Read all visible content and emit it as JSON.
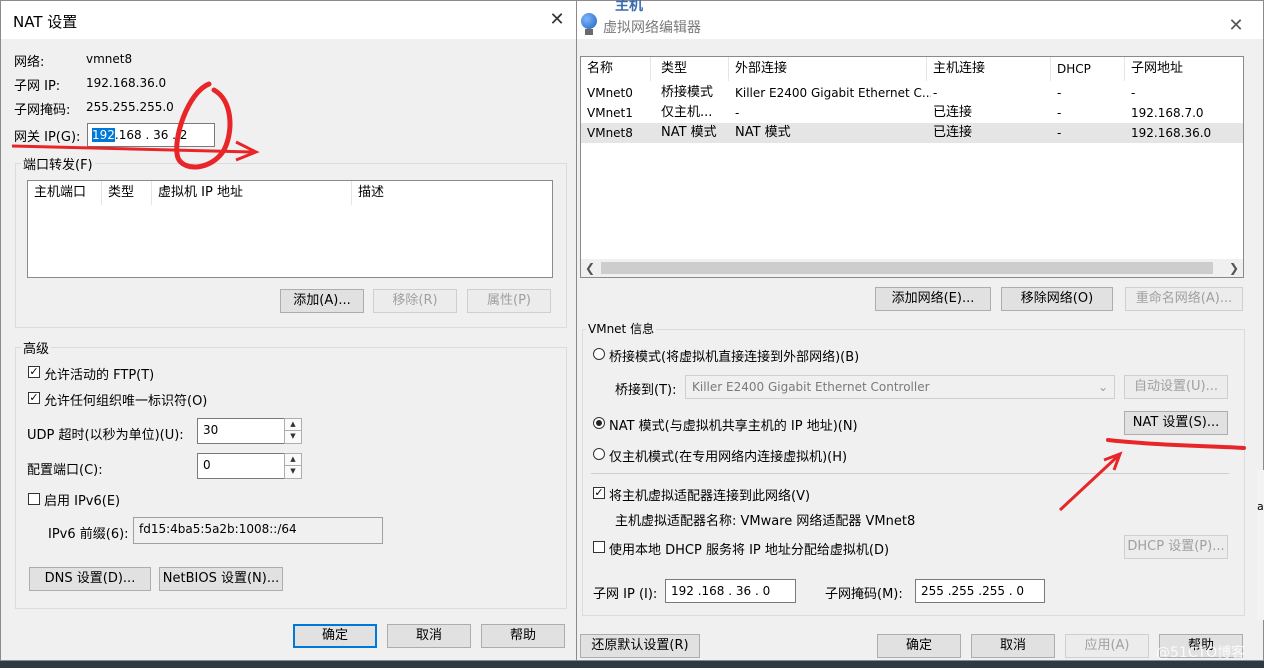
{
  "nat_dialog": {
    "title": "NAT 设置",
    "network_label": "网络:",
    "network_value": "vmnet8",
    "subnet_ip_label": "子网 IP:",
    "subnet_ip_value": "192.168.36.0",
    "subnet_mask_label": "子网掩码:",
    "subnet_mask_value": "255.255.255.0",
    "gateway_label": "网关 IP(G):",
    "gateway_seg1": "192",
    "gateway_rest": ".168 . 36 . 2",
    "port_forward_title": "端口转发(F)",
    "port_columns": [
      "主机端口",
      "类型",
      "虚拟机 IP 地址",
      "描述"
    ],
    "add_button": "添加(A)...",
    "remove_button": "移除(R)",
    "properties_button": "属性(P)",
    "advanced_title": "高级",
    "allow_ftp": "允许活动的 FTP(T)",
    "allow_orgid": "允许任何组织唯一标识符(O)",
    "udp_label": "UDP 超时(以秒为单位)(U):",
    "udp_value": "30",
    "config_port_label": "配置端口(C):",
    "config_port_value": "0",
    "enable_ipv6": "启用 IPv6(E)",
    "ipv6_prefix_label": "IPv6 前缀(6):",
    "ipv6_prefix_value": "fd15:4ba5:5a2b:1008::/64",
    "dns_button": "DNS 设置(D)...",
    "netbios_button": "NetBIOS 设置(N)...",
    "ok_button": "确定",
    "cancel_button": "取消",
    "help_button": "帮助"
  },
  "vne": {
    "title": "虚拟网络编辑器",
    "top_fragment": "主机",
    "columns": [
      "名称",
      "类型",
      "外部连接",
      "主机连接",
      "DHCP",
      "子网地址"
    ],
    "rows": [
      [
        "VMnet0",
        "桥接模式",
        "Killer E2400 Gigabit Ethernet C...",
        "-",
        "-",
        "-"
      ],
      [
        "VMnet1",
        "仅主机...",
        "-",
        "已连接",
        "-",
        "192.168.7.0"
      ],
      [
        "VMnet8",
        "NAT 模式",
        "NAT 模式",
        "已连接",
        "-",
        "192.168.36.0"
      ]
    ],
    "add_network_button": "添加网络(E)...",
    "remove_network_button": "移除网络(O)",
    "rename_network_button": "重命名网络(A)...",
    "vmnet_info_title": "VMnet 信息",
    "bridge_mode": "桥接模式(将虚拟机直接连接到外部网络)(B)",
    "bridge_to_label": "桥接到(T):",
    "bridge_to_value": "Killer E2400 Gigabit Ethernet Controller",
    "auto_settings_button": "自动设置(U)...",
    "nat_mode": "NAT 模式(与虚拟机共享主机的 IP 地址)(N)",
    "nat_settings_button": "NAT 设置(S)...",
    "host_only_mode": "仅主机模式(在专用网络内连接虚拟机)(H)",
    "connect_adapter": "将主机虚拟适配器连接到此网络(V)",
    "adapter_name": "主机虚拟适配器名称: VMware 网络适配器 VMnet8",
    "use_dhcp": "使用本地 DHCP 服务将 IP 地址分配给虚拟机(D)",
    "dhcp_settings_button": "DHCP 设置(P)...",
    "subnet_ip_label": "子网 IP (I):",
    "subnet_ip_value": "192 .168 . 36 . 0",
    "subnet_mask_label": "子网掩码(M):",
    "subnet_mask_value": "255 .255 .255 . 0",
    "restore_defaults_button": "还原默认设置(R)",
    "ok_button": "确定",
    "cancel_button": "取消",
    "apply_button": "应用(A)",
    "help_button": "帮助"
  },
  "watermark": "@51CTO博客",
  "edge_text": "ax",
  "colors": {
    "selection": "#0078d7",
    "annotation": "#e8262a",
    "default_border": "#0078d7"
  }
}
